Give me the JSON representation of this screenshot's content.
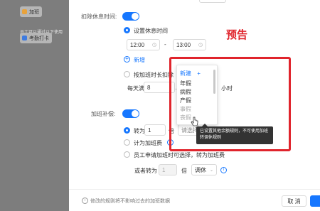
{
  "left_page": {
    "badge1": "加班",
    "text1": "员工可以通过以下使用",
    "badge2": "考勤打卡",
    "colors": {
      "badge1_icon": "#e8a23a",
      "badge2_icon": "#3e7be0"
    }
  },
  "break_section": {
    "label": "扣除休息时间:",
    "toggle_on": true,
    "set_label": "设置休息时间",
    "start_time": "12:00",
    "separator": "-",
    "end_time": "13:00",
    "add_link": "新增",
    "by_duration_label": "按加班时长扣除",
    "daily_prefix": "每天满",
    "daily_value": "8",
    "hours_unit_fragment": "小",
    "hours_unit": "小时"
  },
  "compensation": {
    "label": "加班补偿:",
    "toggle_on": true,
    "option1_prefix": "转为",
    "option1_value": "1",
    "option1_mult": "倍",
    "select_placeholder": "请选择",
    "option2_label": "计为加班费",
    "option3_label": "员工申请加班时可选择，转为加班费",
    "or_label": "或者转为",
    "or_value": "1",
    "or_mult": "倍",
    "or_select": "调休"
  },
  "dropdown": {
    "new_label": "新建",
    "plus": "+",
    "items": [
      "年假",
      "病假",
      "产假",
      "事假",
      "丧假"
    ],
    "dim_items": [
      "事假",
      "丧假"
    ]
  },
  "tooltip": {
    "text": "已设置其他余额规则，不可使用加班转调休规则"
  },
  "annotation": {
    "text": "预告",
    "color": "#e0242c"
  },
  "footer": {
    "info_text": "修改的规则将不影响过去的加班数据",
    "cancel": "取 消"
  },
  "colors": {
    "accent": "#1677ff"
  }
}
